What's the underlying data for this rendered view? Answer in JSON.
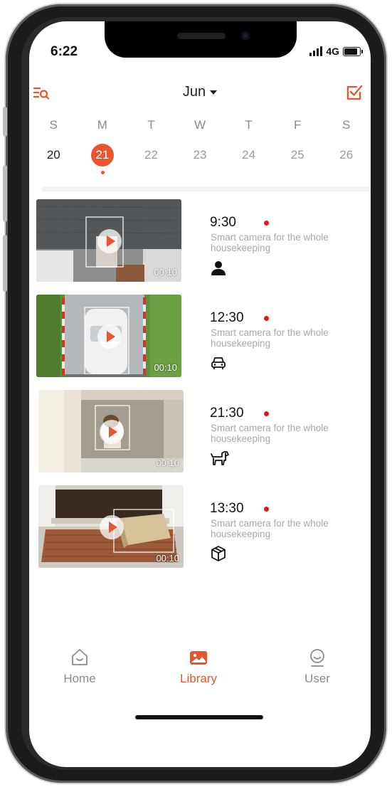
{
  "status": {
    "time": "6:22",
    "network": "4G"
  },
  "header": {
    "month": "Jun",
    "left_icon": "search-list-icon",
    "right_icon": "select-check-icon"
  },
  "calendar": {
    "days": [
      "S",
      "M",
      "T",
      "W",
      "T",
      "F",
      "S"
    ],
    "dates": [
      "20",
      "21",
      "22",
      "23",
      "24",
      "25",
      "26"
    ],
    "selected_date": "21"
  },
  "events": [
    {
      "time": "9:30",
      "description": "Smart camera for the whole housekeeping",
      "duration": "00:10",
      "type_icon": "person-icon"
    },
    {
      "time": "12:30",
      "description": "Smart camera for the whole housekeeping",
      "duration": "00:10",
      "type_icon": "car-icon"
    },
    {
      "time": "21:30",
      "description": "Smart camera for the whole housekeeping",
      "duration": "00:10",
      "type_icon": "dog-icon"
    },
    {
      "time": "13:30",
      "description": "Smart camera for the whole housekeeping",
      "duration": "00:10",
      "type_icon": "package-icon"
    }
  ],
  "tabs": [
    {
      "label": "Home",
      "icon": "home-icon"
    },
    {
      "label": "Library",
      "icon": "library-icon"
    },
    {
      "label": "User",
      "icon": "user-icon"
    }
  ],
  "colors": {
    "accent": "#e8552f",
    "event_dot": "#e8141c",
    "muted_text": "#a8a8a8"
  }
}
